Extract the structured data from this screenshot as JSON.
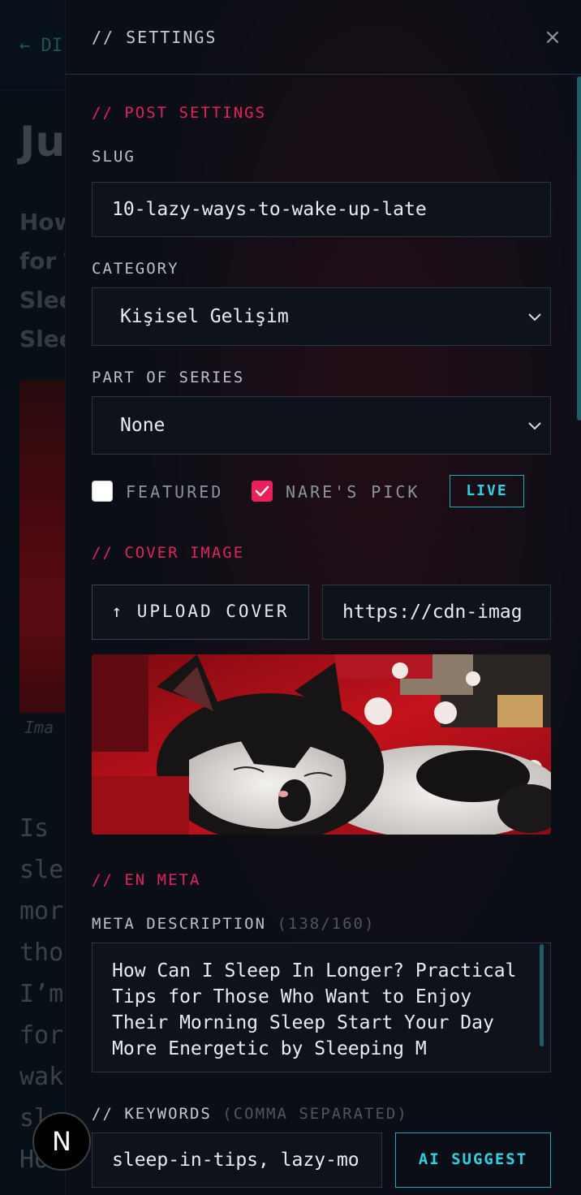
{
  "background": {
    "back_link": "← DI",
    "title": "Ju",
    "subtitle_lines": [
      "How",
      "for T",
      "Slee",
      "Slee"
    ],
    "caption": "Ima",
    "body_lines": [
      "Is",
      "sle",
      "mor",
      "tho",
      "I’m",
      "for",
      "wak",
      "sl",
      "Ho"
    ]
  },
  "panel": {
    "title": "// SETTINGS",
    "close_label": "×"
  },
  "post_settings": {
    "heading": "// POST SETTINGS",
    "slug_label": "SLUG",
    "slug_value": "10-lazy-ways-to-wake-up-late",
    "category_label": "CATEGORY",
    "category_value": "Kişisel Gelişim",
    "series_label": "PART OF SERIES",
    "series_value": "None",
    "featured_label": "FEATURED",
    "featured_checked": false,
    "nares_pick_label": "NARE'S PICK",
    "nares_pick_checked": true,
    "live_badge": "LIVE"
  },
  "cover_image": {
    "heading": "// COVER IMAGE",
    "upload_label": "↑ UPLOAD COVER",
    "url_value": "https://cdn-imag"
  },
  "en_meta": {
    "heading": "// EN META",
    "meta_label": "META DESCRIPTION",
    "meta_count": "(138/160)",
    "meta_value": "How Can I Sleep In Longer? Practical Tips for Those Who Want to Enjoy Their Morning Sleep  Start Your Day More Energetic by Sleeping M",
    "keywords_label": "// KEYWORDS",
    "keywords_hint": "(COMMA SEPARATED)",
    "keywords_value": "sleep-in-tips, lazy-mo",
    "ai_suggest_label": "AI SUGGEST"
  },
  "dev_badge": "N",
  "colors": {
    "accent_pink": "#e0245e",
    "accent_cyan": "#2ed2e2",
    "panel_bg": "#0b0e16"
  }
}
